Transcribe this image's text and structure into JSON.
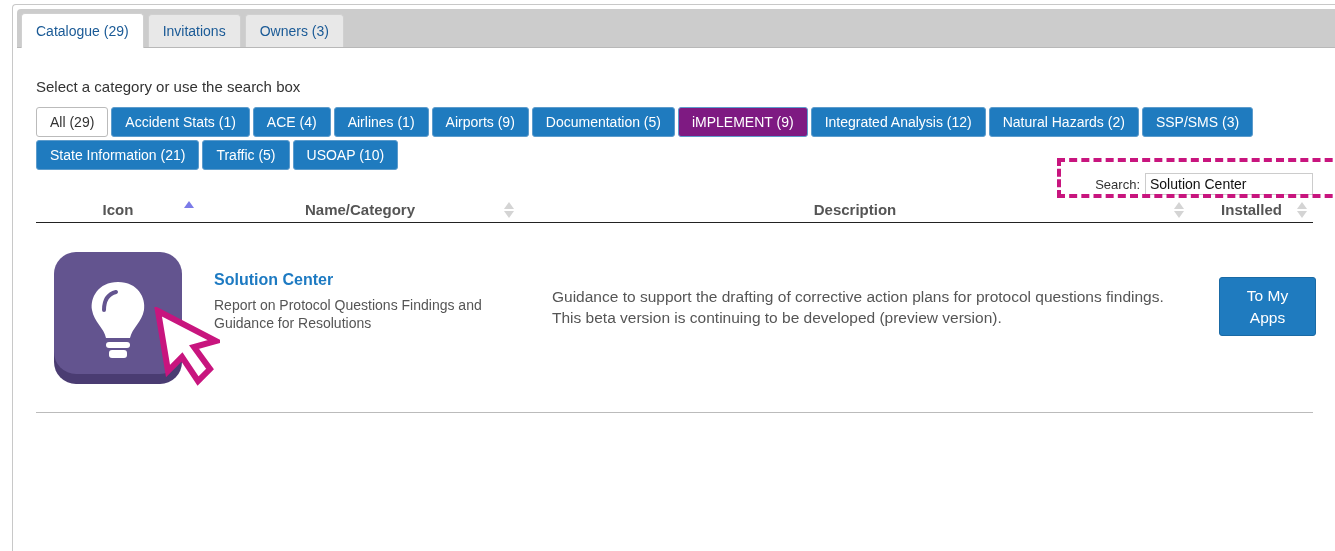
{
  "tabs": [
    {
      "label": "Catalogue (29)",
      "selected": true
    },
    {
      "label": "Invitations",
      "selected": false
    },
    {
      "label": "Owners (3)",
      "selected": false
    }
  ],
  "intro": "Select a category or use the search box",
  "categories": [
    {
      "label": "All (29)",
      "selected": true,
      "color": "#ffffff"
    },
    {
      "label": "Accident Stats (1)",
      "selected": false,
      "color": "#1f7bbf"
    },
    {
      "label": "ACE (4)",
      "selected": false,
      "color": "#1f7bbf"
    },
    {
      "label": "Airlines (1)",
      "selected": false,
      "color": "#1f7bbf"
    },
    {
      "label": "Airports (9)",
      "selected": false,
      "color": "#1f7bbf"
    },
    {
      "label": "Documentation (5)",
      "selected": false,
      "color": "#1f7bbf"
    },
    {
      "label": "iMPLEMENT (9)",
      "selected": false,
      "color": "#7e1a82"
    },
    {
      "label": "Integrated Analysis (12)",
      "selected": false,
      "color": "#1f7bbf"
    },
    {
      "label": "Natural Hazards (2)",
      "selected": false,
      "color": "#1f7bbf"
    },
    {
      "label": "SSP/SMS (3)",
      "selected": false,
      "color": "#1f7bbf"
    },
    {
      "label": "State Information (21)",
      "selected": false,
      "color": "#1f7bbf"
    },
    {
      "label": "Traffic (5)",
      "selected": false,
      "color": "#1f7bbf"
    },
    {
      "label": "USOAP (10)",
      "selected": false,
      "color": "#1f7bbf"
    }
  ],
  "search": {
    "label": "Search:",
    "value": "Solution Center"
  },
  "table": {
    "columns": [
      {
        "label": "Icon",
        "sorted": true
      },
      {
        "label": "Name/Category",
        "sorted": false
      },
      {
        "label": "Description",
        "sorted": false
      },
      {
        "label": "Installed",
        "sorted": false
      }
    ],
    "rows": [
      {
        "name": "Solution Center",
        "category": "Report on Protocol Questions Findings and Guidance for Resolutions",
        "description": "Guidance to support the drafting of corrective action plans for protocol questions findings. This beta version is continuing to be developed (preview version).",
        "action": "To My Apps"
      }
    ]
  }
}
